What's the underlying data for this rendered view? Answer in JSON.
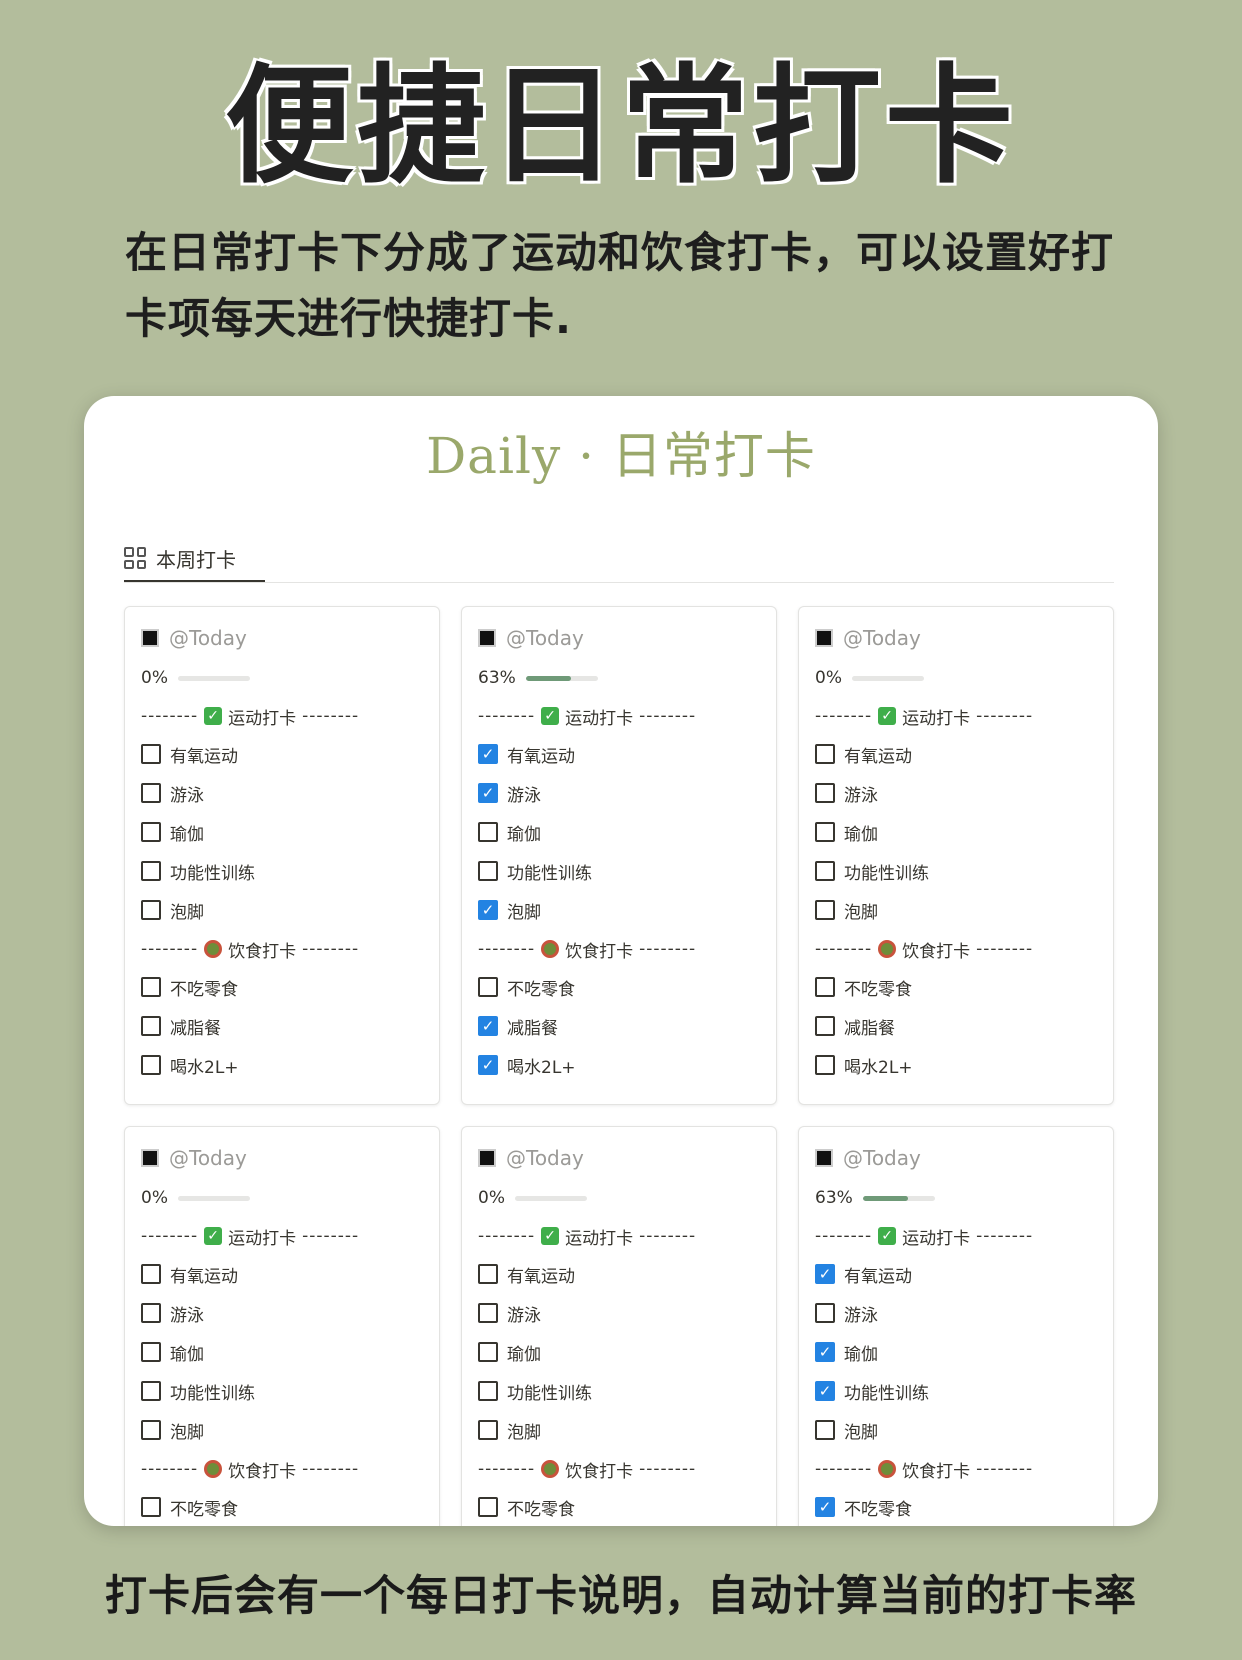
{
  "headline": "便捷日常打卡",
  "intro": "在日常打卡下分成了运动和饮食打卡，可以设置好打卡项每天进行快捷打卡.",
  "footer": "打卡后会有一个每日打卡说明，自动计算当前的打卡率",
  "page": {
    "title": "Daily · 日常打卡",
    "view_tab": "本周打卡"
  },
  "sections": {
    "exercise": "运动打卡",
    "diet": "饮食打卡",
    "dashes": "--------"
  },
  "colors": {
    "background": "#b3bd9c",
    "title": "#9aa86b",
    "checked": "#2383e2",
    "progress_fill": "#6f9a78"
  },
  "cards": [
    {
      "date": "@Today",
      "progress_label": "0%",
      "progress": 0,
      "exercise": [
        {
          "label": "有氧运动",
          "checked": false
        },
        {
          "label": "游泳",
          "checked": false
        },
        {
          "label": "瑜伽",
          "checked": false
        },
        {
          "label": "功能性训练",
          "checked": false
        },
        {
          "label": "泡脚",
          "checked": false
        }
      ],
      "diet": [
        {
          "label": "不吃零食",
          "checked": false
        },
        {
          "label": "减脂餐",
          "checked": false
        },
        {
          "label": "喝水2L+",
          "checked": false
        }
      ]
    },
    {
      "date": "@Today",
      "progress_label": "63%",
      "progress": 0.63,
      "exercise": [
        {
          "label": "有氧运动",
          "checked": true
        },
        {
          "label": "游泳",
          "checked": true
        },
        {
          "label": "瑜伽",
          "checked": false
        },
        {
          "label": "功能性训练",
          "checked": false
        },
        {
          "label": "泡脚",
          "checked": true
        }
      ],
      "diet": [
        {
          "label": "不吃零食",
          "checked": false
        },
        {
          "label": "减脂餐",
          "checked": true
        },
        {
          "label": "喝水2L+",
          "checked": true
        }
      ]
    },
    {
      "date": "@Today",
      "progress_label": "0%",
      "progress": 0,
      "exercise": [
        {
          "label": "有氧运动",
          "checked": false
        },
        {
          "label": "游泳",
          "checked": false
        },
        {
          "label": "瑜伽",
          "checked": false
        },
        {
          "label": "功能性训练",
          "checked": false
        },
        {
          "label": "泡脚",
          "checked": false
        }
      ],
      "diet": [
        {
          "label": "不吃零食",
          "checked": false
        },
        {
          "label": "减脂餐",
          "checked": false
        },
        {
          "label": "喝水2L+",
          "checked": false
        }
      ]
    },
    {
      "date": "@Today",
      "progress_label": "0%",
      "progress": 0,
      "exercise": [
        {
          "label": "有氧运动",
          "checked": false
        },
        {
          "label": "游泳",
          "checked": false
        },
        {
          "label": "瑜伽",
          "checked": false
        },
        {
          "label": "功能性训练",
          "checked": false
        },
        {
          "label": "泡脚",
          "checked": false
        }
      ],
      "diet": [
        {
          "label": "不吃零食",
          "checked": false
        }
      ]
    },
    {
      "date": "@Today",
      "progress_label": "0%",
      "progress": 0,
      "exercise": [
        {
          "label": "有氧运动",
          "checked": false
        },
        {
          "label": "游泳",
          "checked": false
        },
        {
          "label": "瑜伽",
          "checked": false
        },
        {
          "label": "功能性训练",
          "checked": false
        },
        {
          "label": "泡脚",
          "checked": false
        }
      ],
      "diet": [
        {
          "label": "不吃零食",
          "checked": false
        }
      ]
    },
    {
      "date": "@Today",
      "progress_label": "63%",
      "progress": 0.63,
      "exercise": [
        {
          "label": "有氧运动",
          "checked": true
        },
        {
          "label": "游泳",
          "checked": false
        },
        {
          "label": "瑜伽",
          "checked": true
        },
        {
          "label": "功能性训练",
          "checked": true
        },
        {
          "label": "泡脚",
          "checked": false
        }
      ],
      "diet": [
        {
          "label": "不吃零食",
          "checked": true
        }
      ]
    }
  ]
}
